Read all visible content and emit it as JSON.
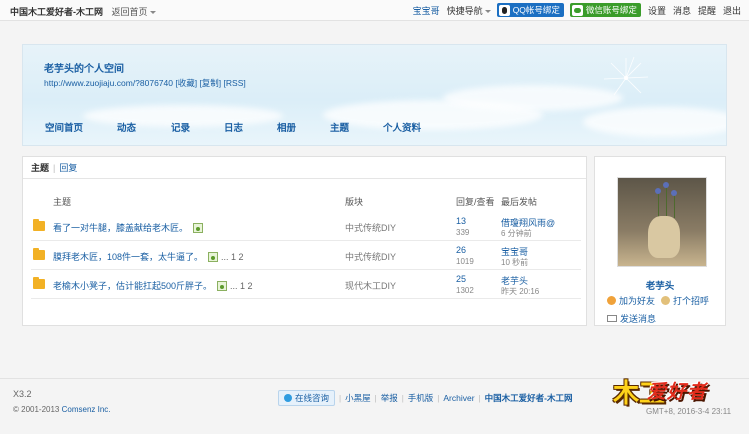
{
  "topbar": {
    "site_name": "中国木工爱好者-木工网",
    "back_home": "返回首页",
    "username": "宝宝哥",
    "quick_nav": "快捷导航",
    "qq_bind": "QQ帐号绑定",
    "wx_bind": "微信账号绑定",
    "settings": "设置",
    "messages": "消息",
    "reminders": "提醒",
    "logout": "退出"
  },
  "banner": {
    "title": "老芋头的个人空间",
    "url_line": "http://www.zuojiaju.com/?8076740 [收藏] [复制] [RSS]",
    "nav": [
      "空间首页",
      "动态",
      "记录",
      "日志",
      "相册",
      "主题",
      "个人资料"
    ]
  },
  "panel": {
    "tab_topics": "主题",
    "tab_replies": "回复",
    "headers": {
      "subject": "主题",
      "forum": "版块",
      "stats": "回复/查看",
      "last": "最后发帖"
    },
    "rows": [
      {
        "subject": "看了一对牛腿，膝盖献给老木匠。",
        "has_image": true,
        "pages": "",
        "forum": "中式传统DIY",
        "replies": "13",
        "views": "339",
        "last_user": "借瓊翔风雨@",
        "last_time": "6 分钟前"
      },
      {
        "subject": "膜拜老木匠，108件一套，太牛逼了。",
        "has_image": true,
        "pages": "... 1 2",
        "forum": "中式传统DIY",
        "replies": "26",
        "views": "1019",
        "last_user": "宝宝哥",
        "last_time": "10 秒前"
      },
      {
        "subject": "老榆木小凳子，估计能扛起500斤胖子。",
        "has_image": true,
        "pages": "... 1 2",
        "forum": "现代木工DIY",
        "replies": "25",
        "views": "1302",
        "last_user": "老芋头",
        "last_time": "昨天 20:16"
      }
    ]
  },
  "profile": {
    "name": "老芋头",
    "add_friend": "加为好友",
    "poke": "打个招呼",
    "send_message": "发送消息"
  },
  "footer": {
    "version": "X3.2",
    "copyright_prefix": "© 2001-2013",
    "company": "Comsenz Inc.",
    "online_consult": "在线咨询",
    "links": [
      "小黑屋",
      "举报",
      "手机版",
      "Archiver"
    ],
    "site_name": "中国木工爱好者-木工网",
    "gmt": "GMT+8, 2016-3-4 23:11"
  },
  "logo": {
    "part1": "木工",
    "part2": "爱好者"
  }
}
